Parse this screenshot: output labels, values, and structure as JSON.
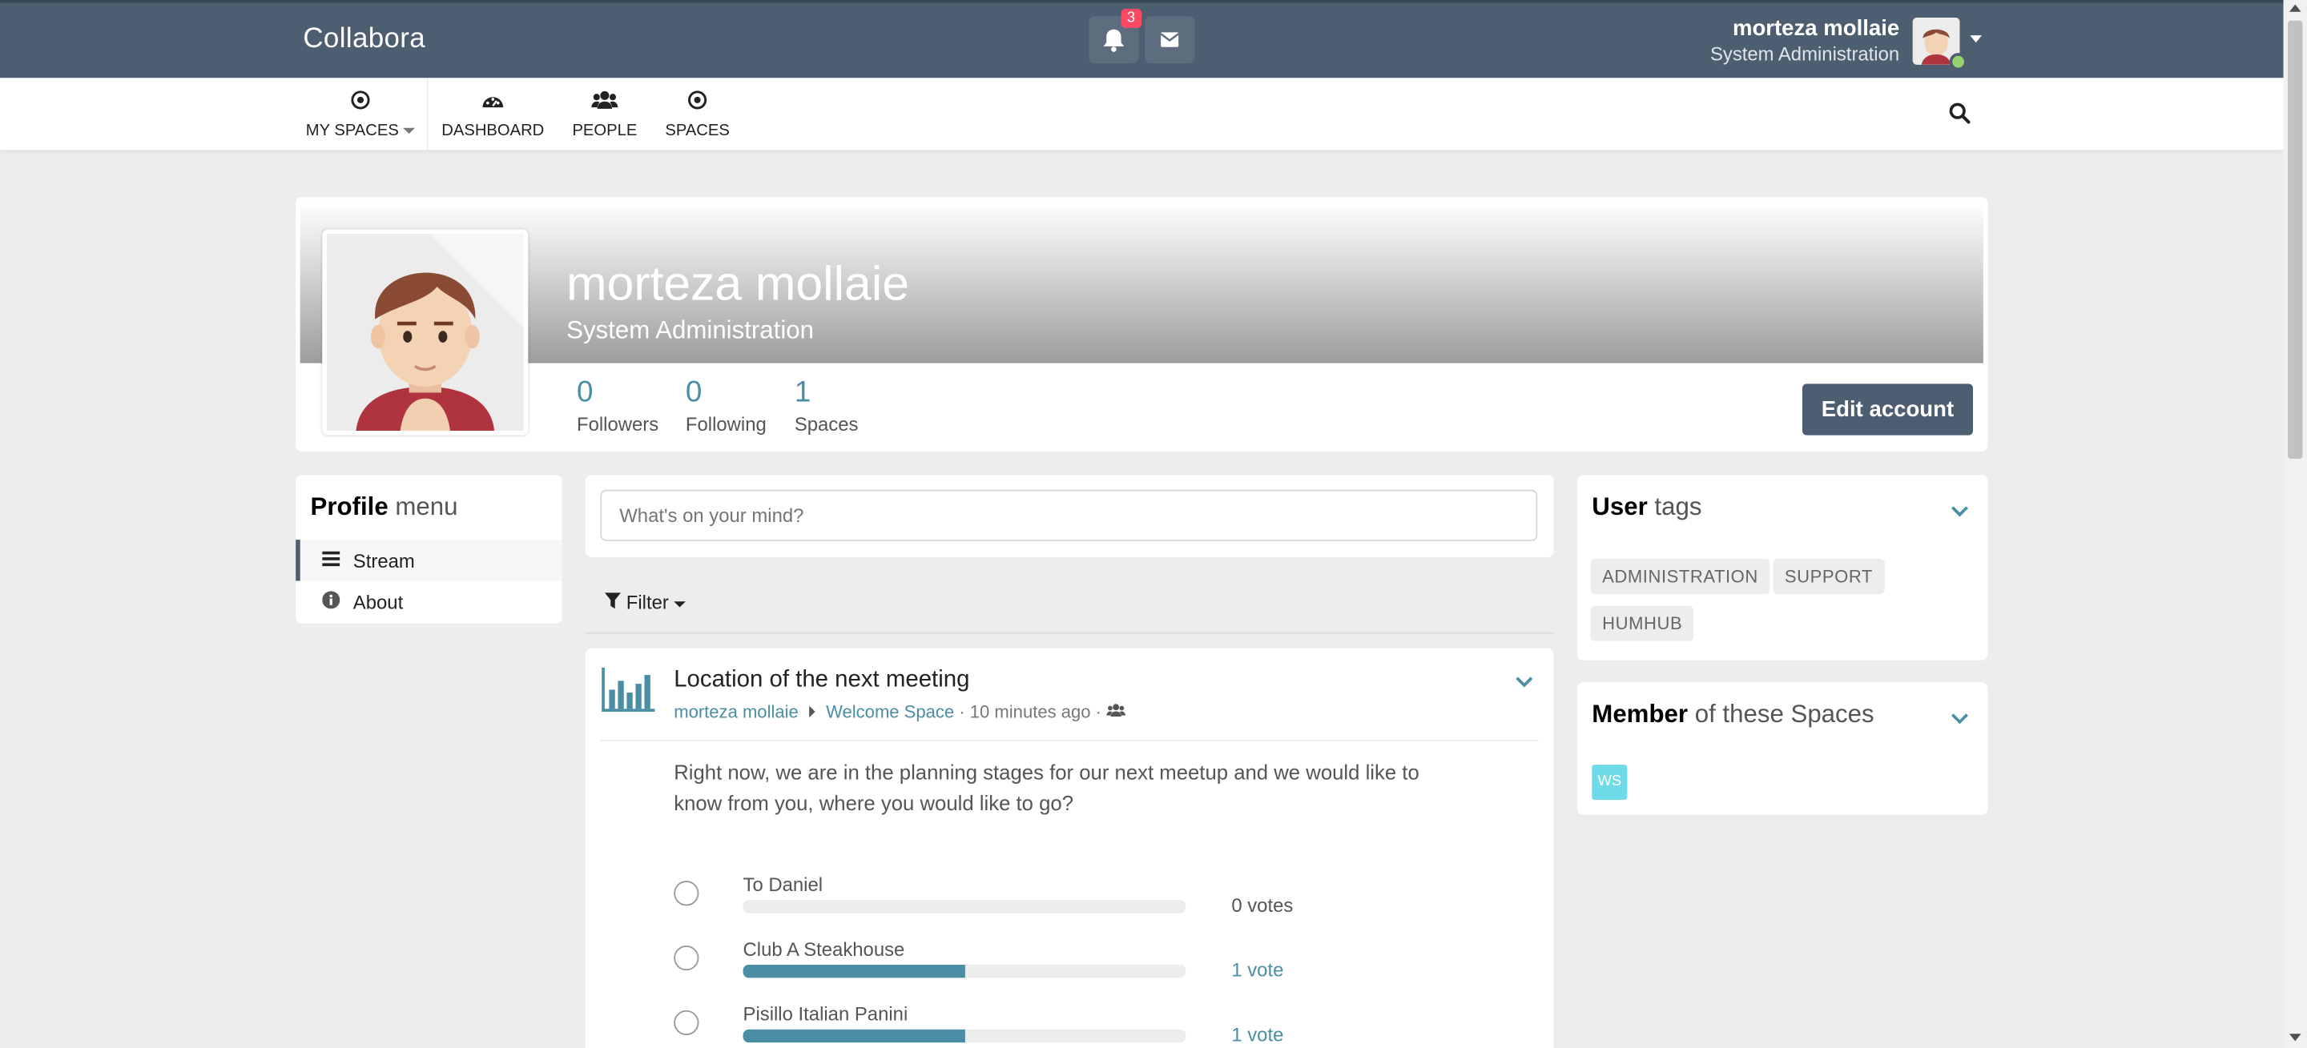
{
  "brand": "Collabora",
  "topbar": {
    "notification_count": "3",
    "user_name": "morteza mollaie",
    "user_role": "System Administration"
  },
  "nav": {
    "my_spaces": "MY SPACES",
    "dashboard": "DASHBOARD",
    "people": "PEOPLE",
    "spaces": "SPACES"
  },
  "profile": {
    "name": "morteza mollaie",
    "role": "System Administration",
    "stats": [
      {
        "num": "0",
        "label": "Followers"
      },
      {
        "num": "0",
        "label": "Following"
      },
      {
        "num": "1",
        "label": "Spaces"
      }
    ],
    "edit_label": "Edit account"
  },
  "profile_menu": {
    "title_bold": "Profile",
    "title_rest": " menu",
    "items": [
      {
        "label": "Stream"
      },
      {
        "label": "About"
      }
    ]
  },
  "composer": {
    "placeholder": "What's on your mind?"
  },
  "filter_label": "Filter",
  "entry": {
    "title": "Location of the next meeting",
    "author": "morteza mollaie",
    "space": "Welcome Space",
    "time": "· 10 minutes ago ·",
    "text": "Right now, we are in the planning stages for our next meetup and we would like to know from you, where you would like to go?",
    "options": [
      {
        "label": "To Daniel",
        "votes": "0 votes",
        "fraction": 0
      },
      {
        "label": "Club A Steakhouse",
        "votes": "1 vote",
        "fraction": 0.5
      },
      {
        "label": "Pisillo Italian Panini",
        "votes": "1 vote",
        "fraction": 0.5
      }
    ]
  },
  "user_tags": {
    "title_bold": "User",
    "title_rest": " tags",
    "tags": [
      "ADMINISTRATION",
      "SUPPORT",
      "HUMHUB"
    ]
  },
  "member_spaces": {
    "title_bold": "Member",
    "title_rest": " of these Spaces",
    "space_badge": "WS"
  },
  "colors": {
    "topbar": "#4d5e70",
    "accent": "#4a8da5",
    "badge": "#fc4a64",
    "space": "#6fdbe8"
  }
}
